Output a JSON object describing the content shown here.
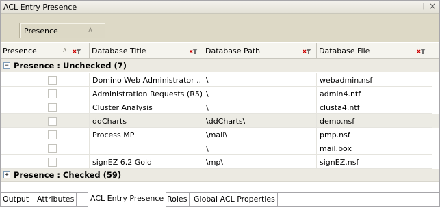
{
  "panel": {
    "title": "ACL Entry Presence",
    "pin_glyph": "†",
    "close_glyph": "×"
  },
  "group_by": {
    "chip_label": "Presence"
  },
  "columns": {
    "presence": "Presence",
    "title": "Database Title",
    "path": "Database Path",
    "file": "Database File"
  },
  "groups": {
    "unchecked": {
      "label": "Presence : Unchecked (7)",
      "toggle": "−",
      "expanded": true
    },
    "checked": {
      "label": "Presence : Checked (59)",
      "toggle": "+",
      "expanded": false
    }
  },
  "rows": [
    {
      "title": "Domino Web Administrator ...",
      "path": "\\",
      "file": "webadmin.nsf",
      "checked": false,
      "selected": false
    },
    {
      "title": "Administration Requests (R5)",
      "path": "\\",
      "file": "admin4.ntf",
      "checked": false,
      "selected": false
    },
    {
      "title": "Cluster Analysis",
      "path": "\\",
      "file": "clusta4.ntf",
      "checked": false,
      "selected": false
    },
    {
      "title": "ddCharts",
      "path": "\\ddCharts\\",
      "file": "demo.nsf",
      "checked": false,
      "selected": true
    },
    {
      "title": "Process MP",
      "path": "\\mail\\",
      "file": "pmp.nsf",
      "checked": false,
      "selected": false
    },
    {
      "title": "",
      "path": "\\",
      "file": "mail.box",
      "checked": false,
      "selected": false
    },
    {
      "title": "signEZ 6.2 Gold",
      "path": "\\mp\\",
      "file": "signEZ.nsf",
      "checked": false,
      "selected": false
    }
  ],
  "tabs": [
    {
      "label": "Output",
      "active": false
    },
    {
      "label": "Attributes",
      "active": false
    },
    {
      "label": "ACL Entry Presence",
      "active": true
    },
    {
      "label": "Roles",
      "active": false
    },
    {
      "label": "Global ACL Properties",
      "active": false
    }
  ],
  "colors": {
    "group_panel_bg": "#ddd9c6",
    "selected_row_bg": "#ecebe4",
    "filter_red": "#cc0000",
    "filter_gray": "#707070"
  }
}
